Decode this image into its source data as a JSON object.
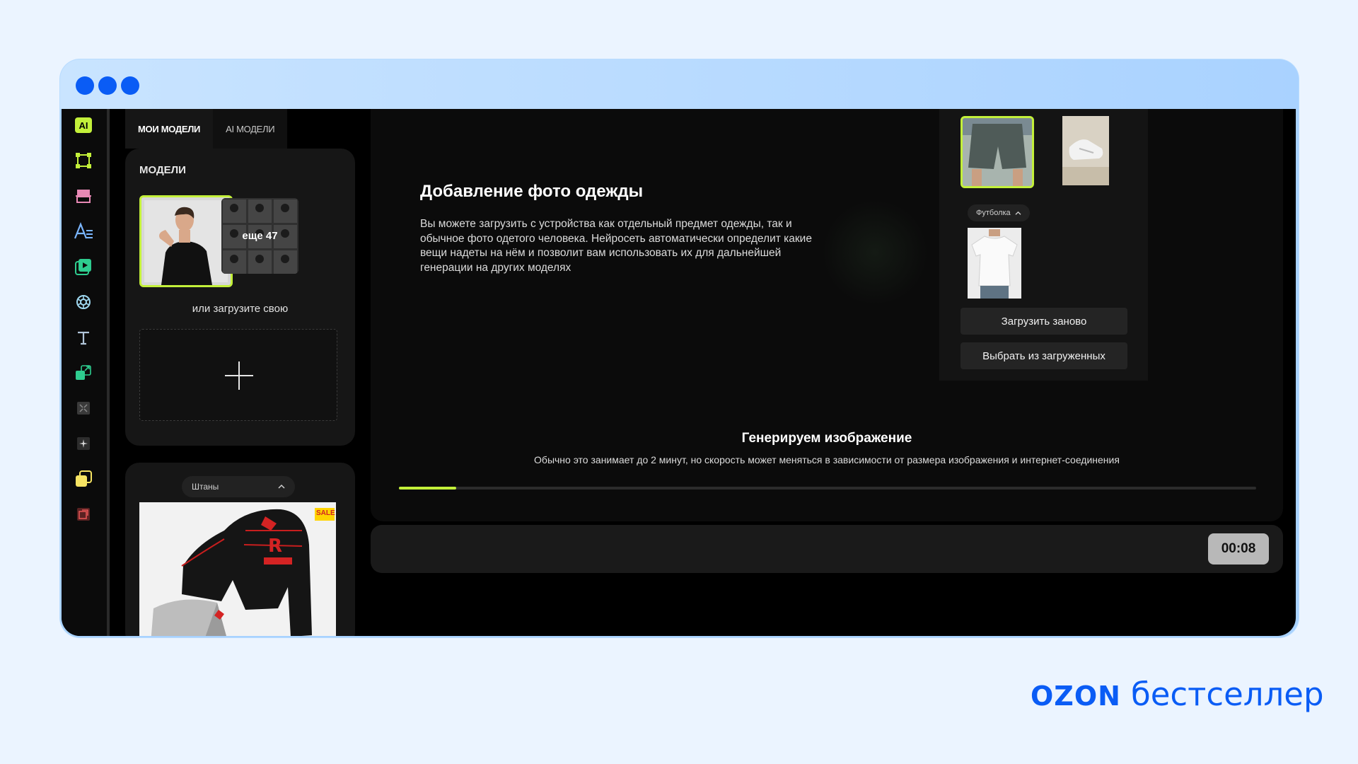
{
  "window": {
    "dots": [
      "dot-1",
      "dot-2",
      "dot-3"
    ]
  },
  "sidebar": {
    "logo_label": "AI",
    "icons": [
      "ai-logo-icon",
      "crop-icon",
      "layout-icon",
      "font-icon",
      "video-icon",
      "openai-icon",
      "text-icon",
      "resize-icon",
      "expand-icon",
      "sparkle-icon",
      "layers-icon",
      "photo-icon"
    ]
  },
  "left_panel": {
    "tabs": [
      "МОИ МОДЕЛИ",
      "AI МОДЕЛИ"
    ],
    "models_label": "МОДЕЛИ",
    "more_label": "еще 47",
    "upload_label": "или загрузите свою",
    "dropdown_label": "Штаны"
  },
  "main": {
    "title": "Добавление фото одежды",
    "description": "Вы можете загрузить с устройства как отдельный предмет одежды, так и обычное фото одетого человека. Нейросеть автоматически определит какие вещи надеты на нём и позволит вам использовать их для дальнейшей генерации на других моделях",
    "chip_label": "Футболка",
    "reupload_button": "Загрузить заново",
    "choose_button": "Выбрать из загруженных",
    "generating_title": "Генерируем изображение",
    "generating_subtitle": "Обычно это занимает до 2 минут, но скорость может меняться в зависимости от размера изображения и интернет-соединения",
    "progress": 0.067
  },
  "bottom_bar": {
    "timer": "00:08"
  },
  "product_image": {
    "sale_label": "SALE"
  },
  "branding": {
    "ozon": "OZON",
    "word": "бестселлер"
  },
  "colors": {
    "accent": "#c3f03a",
    "brand_blue": "#0a5cf5",
    "page_bg": "#ebf4ff"
  }
}
